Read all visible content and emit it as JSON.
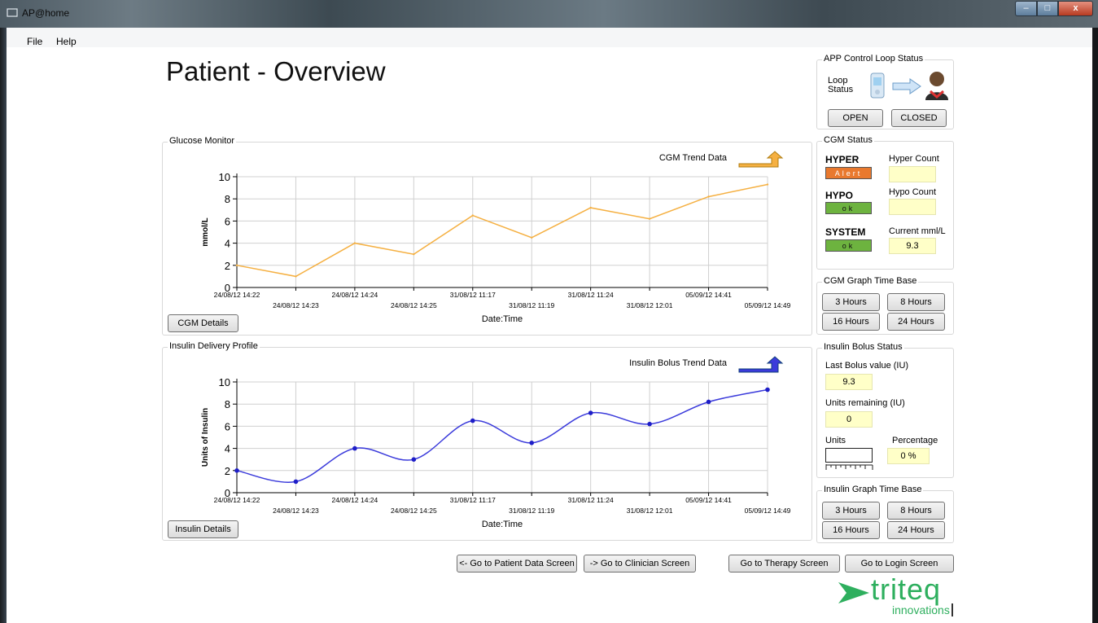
{
  "window": {
    "title": "AP@home",
    "minimize": "–",
    "maximize": "□",
    "close": "x"
  },
  "menu": {
    "file": "File",
    "help": "Help"
  },
  "page_title": "Patient - Overview",
  "loop_status": {
    "group_label": "APP Control Loop Status",
    "label": "Loop Status",
    "open_button": "OPEN",
    "closed_button": "CLOSED",
    "icons": [
      "device-icon",
      "arrow-right-icon",
      "patient-icon"
    ]
  },
  "cgm_status": {
    "group_label": "CGM Status",
    "hyper_label": "HYPER",
    "hyper_indicator": "Alert",
    "hyper_count_label": "Hyper Count",
    "hyper_count_value": "",
    "hypo_label": "HYPO",
    "hypo_indicator": "ok",
    "hypo_count_label": "Hypo Count",
    "hypo_count_value": "",
    "system_label": "SYSTEM",
    "system_indicator": "ok",
    "current_label": "Current mml/L",
    "current_value": "9.3",
    "colors": {
      "alert": "#e9792e",
      "ok": "#6db33f"
    }
  },
  "cgm_time_base": {
    "group_label": "CGM Graph Time Base",
    "buttons": [
      "3 Hours",
      "8 Hours",
      "16 Hours",
      "24 Hours"
    ]
  },
  "bolus_status": {
    "group_label": "Insulin Bolus Status",
    "last_label": "Last Bolus value (IU)",
    "last_value": "9.3",
    "remaining_label": "Units remaining (IU)",
    "remaining_value": "0",
    "units_label": "Units",
    "percentage_label": "Percentage",
    "percentage_value": "0 %"
  },
  "insulin_time_base": {
    "group_label": "Insulin Graph Time Base",
    "buttons": [
      "3 Hours",
      "8 Hours",
      "16 Hours",
      "24 Hours"
    ]
  },
  "glucose_panel": {
    "group_label": "Glucose Monitor",
    "details_button": "CGM Details"
  },
  "insulin_panel": {
    "group_label": "Insulin Delivery Profile",
    "details_button": "Insulin Details"
  },
  "nav": {
    "patient_data": "<- Go to Patient Data Screen",
    "clinician": "-> Go to Clinician Screen",
    "therapy": "Go to Therapy Screen",
    "login": "Go to Login Screen"
  },
  "logo": {
    "name": "triteq",
    "tagline": "innovations",
    "color": "#2eaf5e"
  },
  "chart_data": [
    {
      "type": "line",
      "legend": "CGM Trend Data",
      "xlabel": "Date:Time",
      "ylabel": "mmol/L",
      "ylim": [
        0,
        10
      ],
      "yticks": [
        0,
        2,
        4,
        6,
        8,
        10
      ],
      "x": [
        "24/08/12 14:22",
        "24/08/12 14:23",
        "24/08/12 14:24",
        "24/08/12 14:25",
        "31/08/12 11:17",
        "31/08/12 11:19",
        "31/08/12 11:24",
        "31/08/12 12:01",
        "05/09/12 14:41",
        "05/09/12 14:49"
      ],
      "values": [
        2.0,
        1.0,
        4.0,
        3.0,
        6.5,
        4.5,
        7.2,
        6.2,
        8.2,
        9.3
      ],
      "color": "#f5b042",
      "grid": true
    },
    {
      "type": "line",
      "legend": "Insulin Bolus Trend Data",
      "xlabel": "Date:Time",
      "ylabel": "Units of Insulin",
      "ylim": [
        0,
        10
      ],
      "yticks": [
        0,
        2,
        4,
        6,
        8,
        10
      ],
      "x": [
        "24/08/12 14:22",
        "24/08/12 14:23",
        "24/08/12 14:24",
        "24/08/12 14:25",
        "31/08/12 11:17",
        "31/08/12 11:19",
        "31/08/12 11:24",
        "31/08/12 12:01",
        "05/09/12 14:41",
        "05/09/12 14:49"
      ],
      "values": [
        2.0,
        1.0,
        4.0,
        3.0,
        6.5,
        4.5,
        7.2,
        6.2,
        8.2,
        9.3
      ],
      "color": "#3b3bdb",
      "grid": true
    }
  ]
}
